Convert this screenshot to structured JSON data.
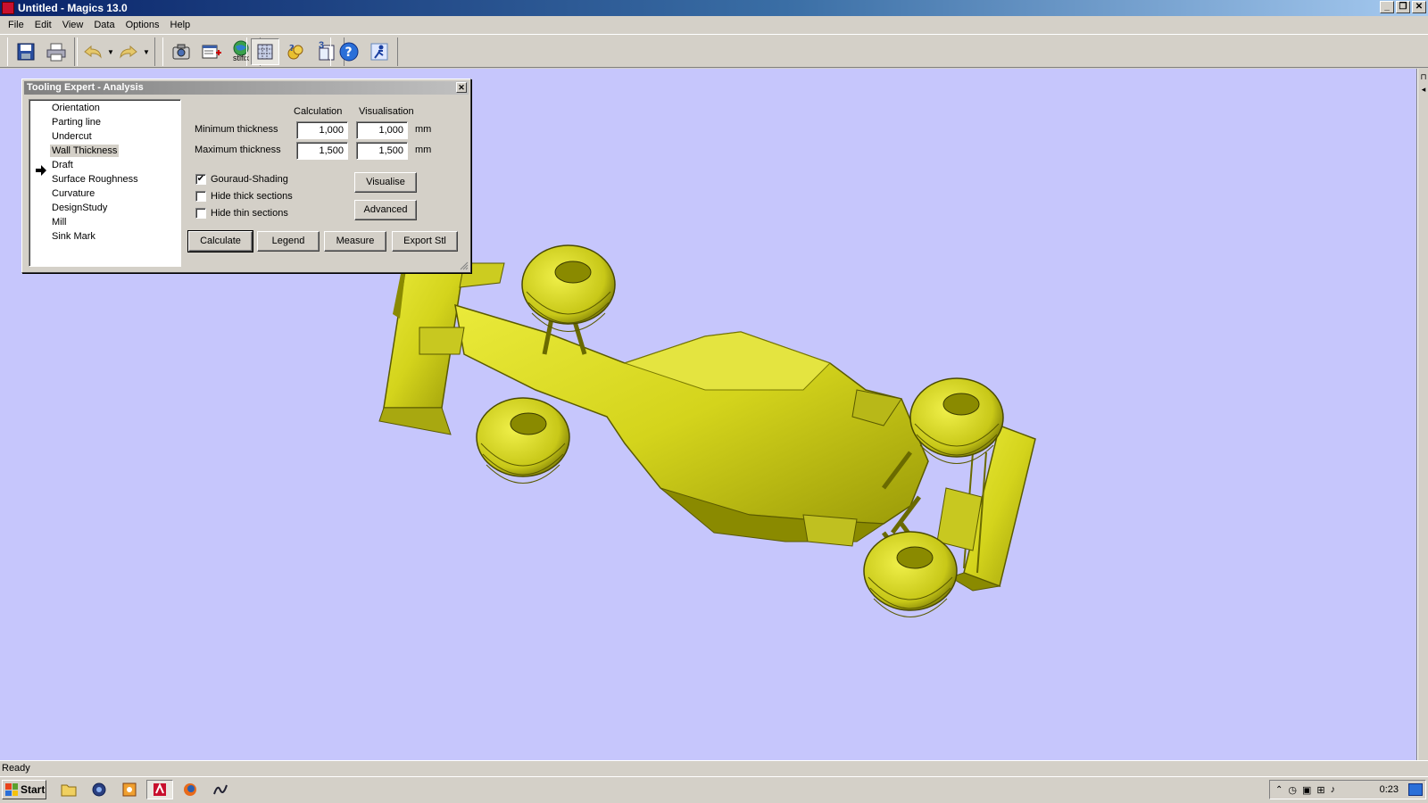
{
  "window": {
    "title": "Untitled - Magics 13.0",
    "buttons": [
      "_",
      "❐",
      "✕"
    ]
  },
  "menu": [
    "File",
    "Edit",
    "View",
    "Data",
    "Options",
    "Help"
  ],
  "toolbar": {
    "stlfix_label": "stlfix",
    "badge_3": "3"
  },
  "dialog": {
    "title": "Tooling Expert - Analysis",
    "close": "✕",
    "list_items": [
      "Orientation",
      "Parting line",
      "Undercut",
      "Wall Thickness",
      "Draft",
      "Surface Roughness",
      "Curvature",
      "DesignStudy",
      "Mill",
      "Sink Mark"
    ],
    "selected_item": "Wall Thickness",
    "col_calculation": "Calculation",
    "col_visualisation": "Visualisation",
    "min_label": "Minimum thickness",
    "max_label": "Maximum thickness",
    "min_calc": "1,000",
    "min_vis": "1,000",
    "max_calc": "1,500",
    "max_vis": "1,500",
    "unit": "mm",
    "gouraud_label": "Gouraud-Shading",
    "gouraud_checked": "✔",
    "hide_thick_label": "Hide thick sections",
    "hide_thin_label": "Hide thin sections",
    "visualise_btn": "Visualise",
    "advanced_btn": "Advanced",
    "calculate_btn": "Calculate",
    "legend_btn": "Legend",
    "measure_btn": "Measure",
    "export_btn": "Export Stl"
  },
  "status": {
    "text": "Ready"
  },
  "taskbar": {
    "start": "Start",
    "clock": "0:23"
  },
  "colors": {
    "viewport": "#c6c6fc",
    "model": "#d4d41c",
    "title_start": "#0a246a",
    "title_end": "#a6caf0"
  }
}
